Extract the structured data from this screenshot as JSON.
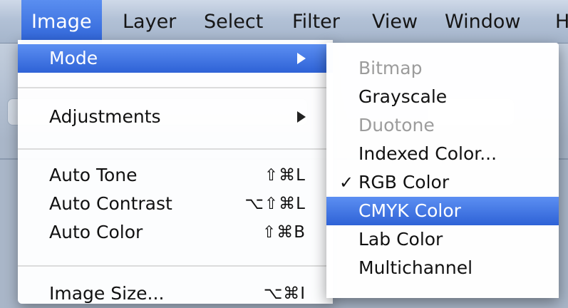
{
  "menubar": {
    "items": [
      {
        "label": "Image",
        "active": true
      },
      {
        "label": "Layer"
      },
      {
        "label": "Select"
      },
      {
        "label": "Filter"
      },
      {
        "label": "View"
      },
      {
        "label": "Window"
      },
      {
        "label": "H"
      }
    ]
  },
  "image_menu": {
    "mode": "Mode",
    "adjustments": "Adjustments",
    "auto_tone": {
      "label": "Auto Tone",
      "shortcut": "⇧⌘L"
    },
    "auto_contrast": {
      "label": "Auto Contrast",
      "shortcut": "⌥⇧⌘L"
    },
    "auto_color": {
      "label": "Auto Color",
      "shortcut": "⇧⌘B"
    },
    "image_size": {
      "label": "Image Size...",
      "shortcut": "⌥⌘I"
    }
  },
  "mode_submenu": {
    "bitmap": "Bitmap",
    "grayscale": "Grayscale",
    "duotone": "Duotone",
    "indexed": "Indexed Color...",
    "rgb": "RGB Color",
    "rgb_check": "✓",
    "cmyk": "CMYK Color",
    "lab": "Lab Color",
    "multichannel": "Multichannel"
  },
  "colors": {
    "highlight": "#2e62d6",
    "disabled_text": "#9c9c9c"
  }
}
